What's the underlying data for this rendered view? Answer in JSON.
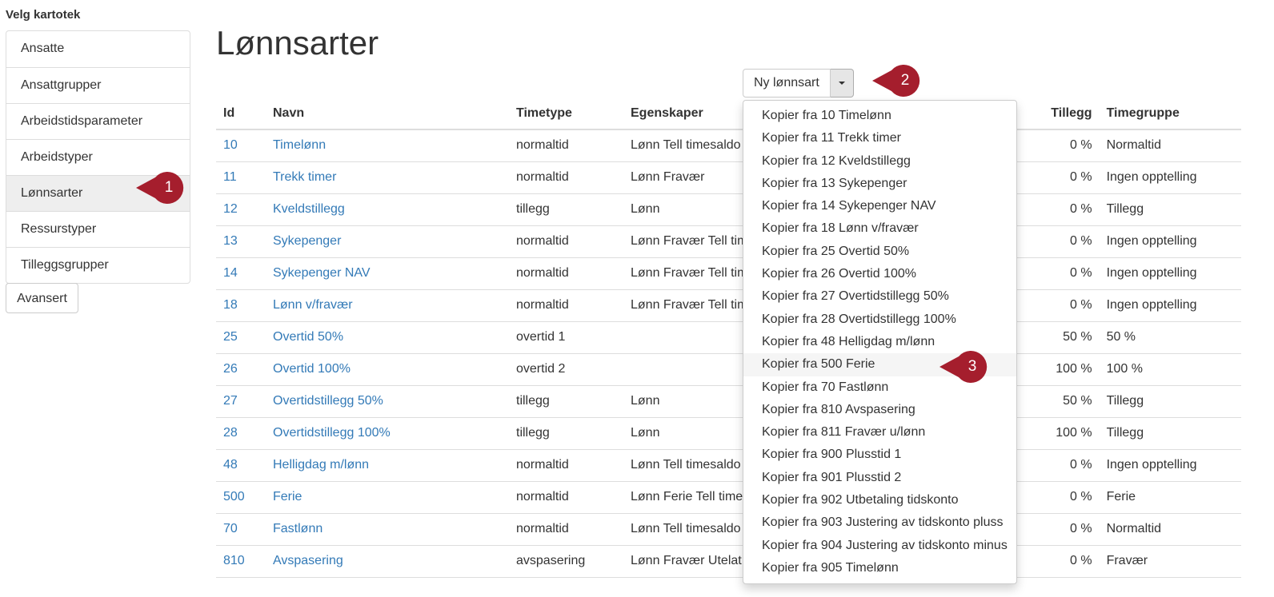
{
  "sidebar": {
    "title": "Velg kartotek",
    "items": [
      {
        "label": "Ansatte",
        "active": false
      },
      {
        "label": "Ansattgrupper",
        "active": false
      },
      {
        "label": "Arbeidstidsparameter",
        "active": false
      },
      {
        "label": "Arbeidstyper",
        "active": false
      },
      {
        "label": "Lønnsarter",
        "active": true
      },
      {
        "label": "Ressurstyper",
        "active": false
      },
      {
        "label": "Tilleggsgrupper",
        "active": false
      }
    ],
    "advanced_button": "Avansert"
  },
  "page": {
    "title": "Lønnsarter"
  },
  "new_button": {
    "label": "Ny lønnsart"
  },
  "table": {
    "headers": {
      "id": "Id",
      "navn": "Navn",
      "timetype": "Timetype",
      "egenskaper": "Egenskaper",
      "tillegg": "Tillegg",
      "timegruppe": "Timegruppe"
    },
    "rows": [
      {
        "id": "10",
        "navn": "Timelønn",
        "timetype": "normaltid",
        "egenskaper": "Lønn Tell timesaldo",
        "tillegg": "0 %",
        "timegruppe": "Normaltid"
      },
      {
        "id": "11",
        "navn": "Trekk timer",
        "timetype": "normaltid",
        "egenskaper": "Lønn Fravær",
        "tillegg": "0 %",
        "timegruppe": "Ingen opptelling"
      },
      {
        "id": "12",
        "navn": "Kveldstillegg",
        "timetype": "tillegg",
        "egenskaper": "Lønn",
        "tillegg": "0 %",
        "timegruppe": "Tillegg"
      },
      {
        "id": "13",
        "navn": "Sykepenger",
        "timetype": "normaltid",
        "egenskaper": "Lønn Fravær Tell tim",
        "tillegg": "0 %",
        "timegruppe": "Ingen opptelling"
      },
      {
        "id": "14",
        "navn": "Sykepenger NAV",
        "timetype": "normaltid",
        "egenskaper": "Lønn Fravær Tell tim",
        "tillegg": "0 %",
        "timegruppe": "Ingen opptelling"
      },
      {
        "id": "18",
        "navn": "Lønn v/fravær",
        "timetype": "normaltid",
        "egenskaper": "Lønn Fravær Tell tim",
        "tillegg": "0 %",
        "timegruppe": "Ingen opptelling"
      },
      {
        "id": "25",
        "navn": "Overtid 50%",
        "timetype": "overtid 1",
        "egenskaper": "",
        "tillegg": "50 %",
        "timegruppe": "50 %"
      },
      {
        "id": "26",
        "navn": "Overtid 100%",
        "timetype": "overtid 2",
        "egenskaper": "",
        "tillegg": "100 %",
        "timegruppe": "100 %"
      },
      {
        "id": "27",
        "navn": "Overtidstillegg 50%",
        "timetype": "tillegg",
        "egenskaper": "Lønn",
        "tillegg": "50 %",
        "timegruppe": "Tillegg"
      },
      {
        "id": "28",
        "navn": "Overtidstillegg 100%",
        "timetype": "tillegg",
        "egenskaper": "Lønn",
        "tillegg": "100 %",
        "timegruppe": "Tillegg"
      },
      {
        "id": "48",
        "navn": "Helligdag m/lønn",
        "timetype": "normaltid",
        "egenskaper": "Lønn Tell timesaldo",
        "tillegg": "0 %",
        "timegruppe": "Ingen opptelling"
      },
      {
        "id": "500",
        "navn": "Ferie",
        "timetype": "normaltid",
        "egenskaper": "Lønn Ferie Tell times",
        "tillegg": "0 %",
        "timegruppe": "Ferie"
      },
      {
        "id": "70",
        "navn": "Fastlønn",
        "timetype": "normaltid",
        "egenskaper": "Lønn Tell timesaldo U",
        "tillegg": "0 %",
        "timegruppe": "Normaltid"
      },
      {
        "id": "810",
        "navn": "Avspasering",
        "timetype": "avspasering",
        "egenskaper": "Lønn Fravær Utelat t",
        "tillegg": "0 %",
        "timegruppe": "Fravær"
      }
    ]
  },
  "dropdown": {
    "items": [
      "Kopier fra 10 Timelønn",
      "Kopier fra 11 Trekk timer",
      "Kopier fra 12 Kveldstillegg",
      "Kopier fra 13 Sykepenger",
      "Kopier fra 14 Sykepenger NAV",
      "Kopier fra 18 Lønn v/fravær",
      "Kopier fra 25 Overtid 50%",
      "Kopier fra 26 Overtid 100%",
      "Kopier fra 27 Overtidstillegg 50%",
      "Kopier fra 28 Overtidstillegg 100%",
      "Kopier fra 48 Helligdag m/lønn",
      "Kopier fra 500 Ferie",
      "Kopier fra 70 Fastlønn",
      "Kopier fra 810 Avspasering",
      "Kopier fra 811 Fravær u/lønn",
      "Kopier fra 900 Plusstid 1",
      "Kopier fra 901 Plusstid 2",
      "Kopier fra 902 Utbetaling tidskonto",
      "Kopier fra 903 Justering av tidskonto pluss",
      "Kopier fra 904 Justering av tidskonto minus",
      "Kopier fra 905 Timelønn"
    ],
    "hovered": "Kopier fra 500 Ferie"
  },
  "callouts": {
    "one": "1",
    "two": "2",
    "three": "3",
    "color": "#a51e2d"
  },
  "colors": {
    "link": "#337ab7",
    "border": "#dddddd",
    "active_bg": "#eeeeee"
  }
}
